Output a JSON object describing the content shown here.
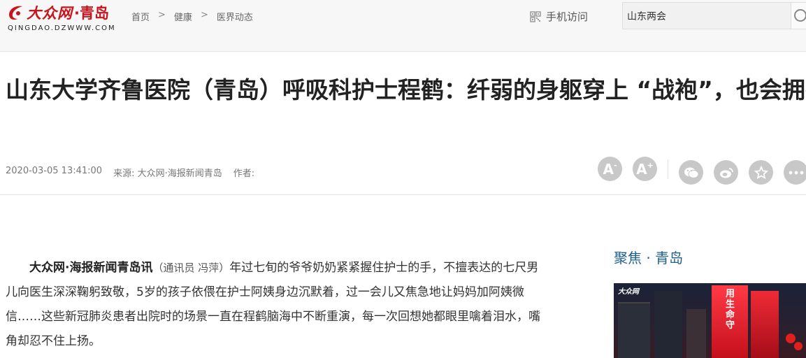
{
  "header": {
    "logo": {
      "text": "大众网",
      "city": "·青岛",
      "domain": "QINGDAO.DZWWW.COM"
    },
    "breadcrumb": [
      "首页",
      "健康",
      "医界动态"
    ],
    "breadcrumb_sep": ">",
    "mobile_label": "手机访问",
    "search": {
      "value": "山东两会"
    }
  },
  "article": {
    "title": "山东大学齐鲁医院（青岛）呼吸科护士程鹤：纤弱的身躯穿上 “战袍”，也会拥有非凡的力量",
    "meta": {
      "datetime": "2020-03-05 13:41:00",
      "source": "来源: 大众网·海报新闻青岛",
      "author": "作者:"
    },
    "lead": "大众网·海报新闻青岛讯",
    "credit": "（通讯员 冯萍）",
    "body": "年过七旬的爷爷奶奶紧紧握住护士的手，不擅表达的七尺男儿向医生深深鞠躬致敬，5岁的孩子依偎在护士阿姨身边沉默着，过一会儿又焦急地让妈妈加阿姨微信……这些新冠肺炎患者出院时的场景一直在程鹤脑海中不断重演，每一次回想她都眼里噙着泪水，嘴角却忍不住上扬。"
  },
  "tools": {
    "font_decrease": "A",
    "font_increase": "A",
    "share": [
      "wechat-icon",
      "weibo-icon",
      "favorite-star-icon",
      "more-icon"
    ]
  },
  "sidebar": {
    "title": "聚焦 · 青岛",
    "image_logo_text": "大众网",
    "image_caption": "用生命守"
  },
  "colors": {
    "brand": "#c8151d",
    "sidebar_title": "#1f5f8b",
    "icon_bg": "#c8c8c8"
  }
}
